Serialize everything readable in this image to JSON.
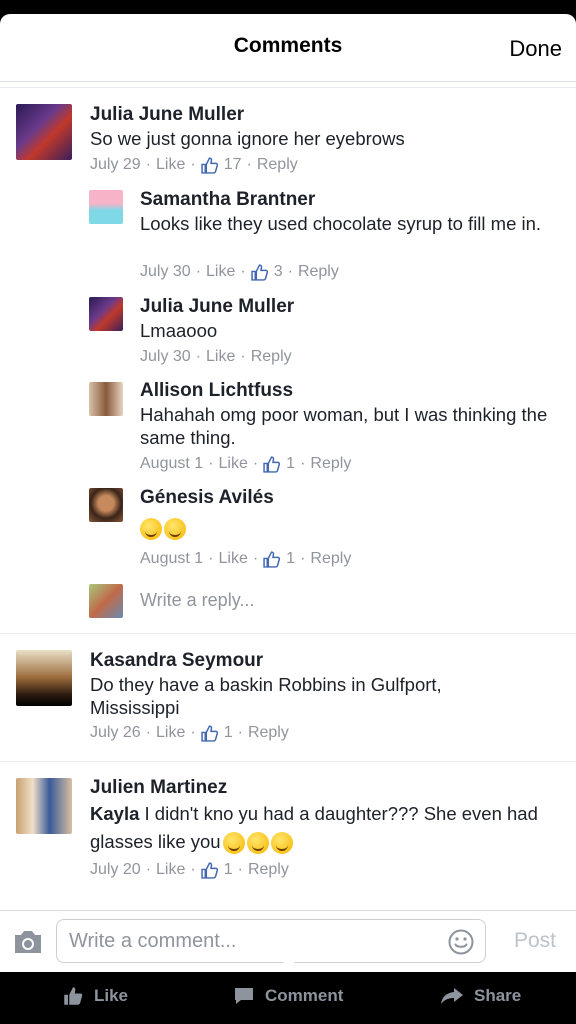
{
  "header": {
    "title": "Comments",
    "done_label": "Done"
  },
  "comments": [
    {
      "name": "Julia June Muller",
      "text": "So we just gonna ignore her eyebrows",
      "date": "July 29",
      "like": "Like",
      "count": "17",
      "reply": "Reply"
    },
    {
      "name": "Samantha Brantner",
      "text": "Looks like they used chocolate syrup to fill me in.",
      "date": "July 30",
      "like": "Like",
      "count": "3",
      "reply": "Reply"
    },
    {
      "name": "Julia June Muller",
      "text": "Lmaaooo",
      "date": "July 30",
      "like": "Like",
      "reply": "Reply"
    },
    {
      "name": "Allison Lichtfuss",
      "text": "Hahahah omg poor woman, but I was thinking the same thing.",
      "date": "August 1",
      "like": "Like",
      "count": "1",
      "reply": "Reply"
    },
    {
      "name": "Génesis Avilés",
      "text": "",
      "date": "August 1",
      "like": "Like",
      "count": "1",
      "reply": "Reply"
    },
    {
      "name": "Kasandra Seymour",
      "text": "Do they have a baskin Robbins in Gulfport, Mississippi",
      "date": "July 26",
      "like": "Like",
      "count": "1",
      "reply": "Reply"
    },
    {
      "name": "Julien Martinez",
      "mention": "Kayla",
      "text": " I didn't kno yu had a daughter??? She even had glasses like you",
      "date": "July 20",
      "like": "Like",
      "count": "1",
      "reply": "Reply"
    }
  ],
  "reply_placeholder": "Write a reply...",
  "composer": {
    "placeholder": "Write a comment...",
    "post_label": "Post"
  },
  "tabbar": {
    "like": "Like",
    "comment": "Comment",
    "share": "Share"
  },
  "colors": {
    "meta": "#90949c",
    "like_blue": "#4267b2"
  }
}
